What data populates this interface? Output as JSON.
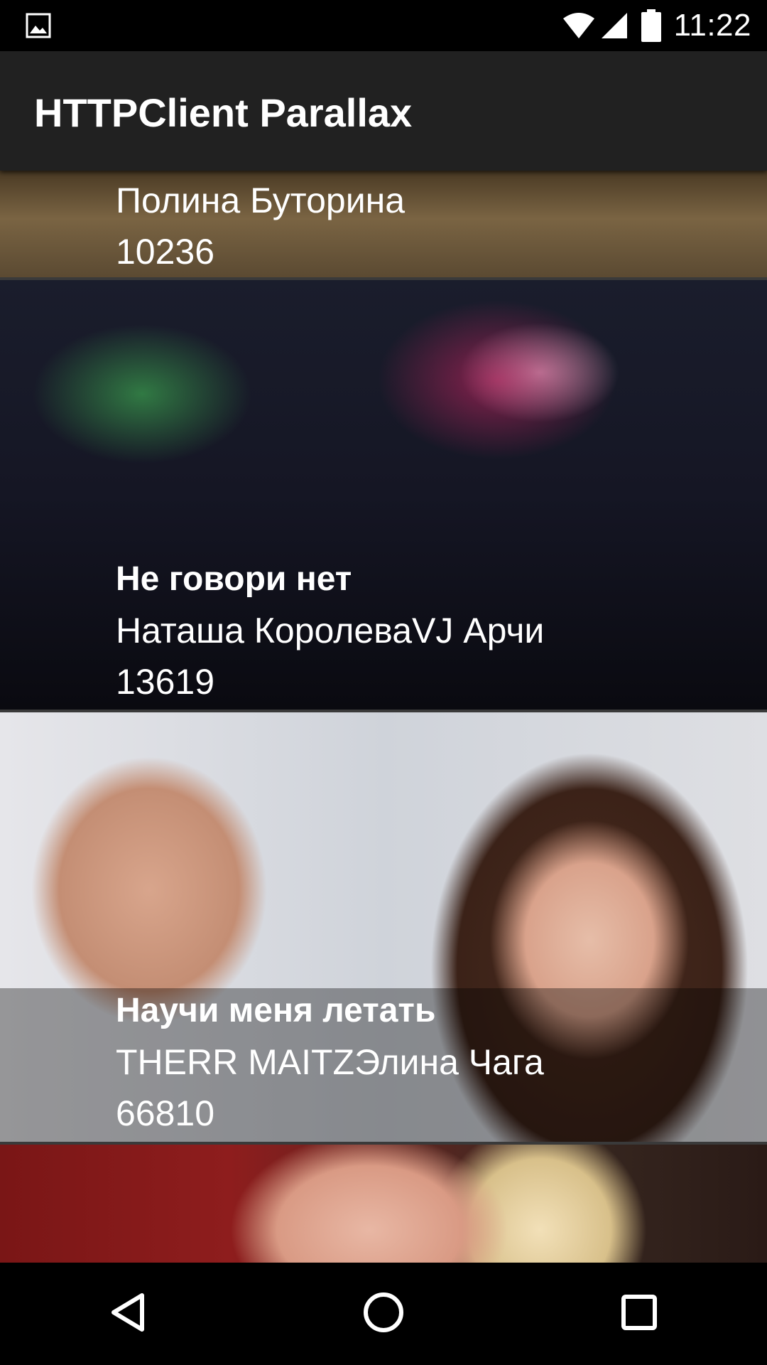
{
  "status_bar": {
    "time": "11:22",
    "icons": [
      "gallery-icon",
      "wifi-icon",
      "signal-icon",
      "battery-icon"
    ]
  },
  "app_bar": {
    "title": "HTTPClient Parallax"
  },
  "list": {
    "items": [
      {
        "title": "",
        "artist": "Полина Буторина",
        "views": "10236"
      },
      {
        "title": "Не говори нет",
        "artist": "Наташа КоролеваVJ Арчи",
        "views": "13619"
      },
      {
        "title": "Научи меня летать",
        "artist": "THERR MAITZЭлина Чага",
        "views": "66810"
      },
      {
        "title": "",
        "artist": "",
        "views": ""
      }
    ]
  },
  "nav_bar": {
    "icons": [
      "back-icon",
      "home-icon",
      "recents-icon"
    ]
  },
  "colors": {
    "app_bar_bg": "#212121",
    "status_bar_bg": "#000000",
    "text": "#ffffff"
  }
}
